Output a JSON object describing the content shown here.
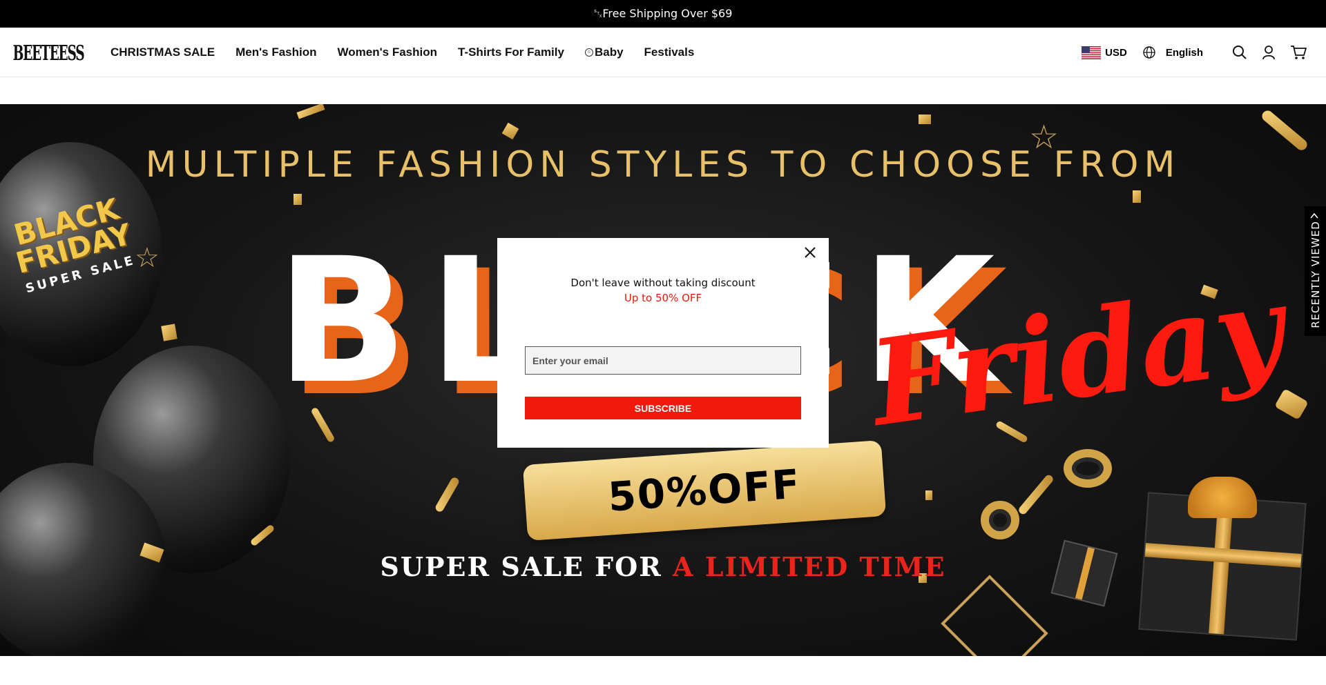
{
  "topbar": {
    "announcement": "␂Free Shipping Over $69"
  },
  "header": {
    "logo_text": "BEETEESS",
    "nav": [
      {
        "label": "CHRISTMAS SALE"
      },
      {
        "label": "Men's Fashion"
      },
      {
        "label": "Women's Fashion"
      },
      {
        "label": "T-Shirts For Family"
      },
      {
        "label": "Baby"
      },
      {
        "label": "Festivals"
      }
    ],
    "currency": "USD",
    "language": "English"
  },
  "banner": {
    "headline": "MULTIPLE FASHION STYLES TO CHOOSE FROM",
    "big_word": "BLACK",
    "script_word": "Friday",
    "ribbon_text": "50%OFF",
    "super_sale_white": "SUPER SALE FOR ",
    "super_sale_red": "A LIMITED TIME",
    "badge_line1": "BLACK",
    "badge_line2": "FRIDAY",
    "badge_line3": "SUPER SALE"
  },
  "recently_viewed": {
    "label": "RECENTLY VIEWED"
  },
  "popup": {
    "title": "Don't leave without taking discount",
    "subtitle": "Up to 50% OFF",
    "email_placeholder": "Enter your email",
    "subscribe_label": "SUBSCRIBE"
  },
  "colors": {
    "accent_red": "#f01a0c",
    "gold": "#e8c06a",
    "orange": "#e86418",
    "topbar_bg": "#000000"
  },
  "icons": [
    "globe-icon",
    "search-icon",
    "account-icon",
    "cart-icon",
    "close-icon",
    "chevron-up-icon",
    "us-flag-icon"
  ]
}
